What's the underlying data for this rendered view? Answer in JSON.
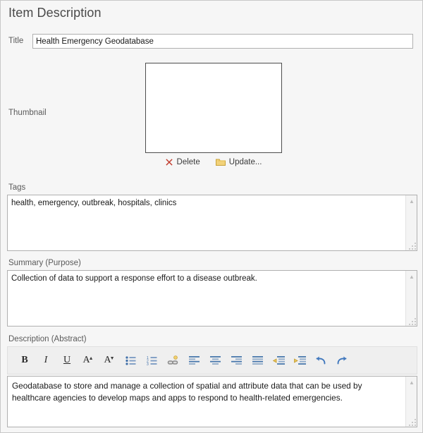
{
  "header": {
    "title": "Item Description"
  },
  "title_field": {
    "label": "Title",
    "value": "Health Emergency Geodatabase",
    "placeholder": ""
  },
  "thumbnail": {
    "label": "Thumbnail",
    "image": "",
    "delete_label": "Delete",
    "delete_icon": "close-x-icon",
    "update_label": "Update...",
    "update_icon": "folder-icon",
    "delete_icon_color": "#c0392b",
    "folder_icon_color": "#e8c35a"
  },
  "tags": {
    "label": "Tags",
    "value": "health, emergency, outbreak, hospitals, clinics",
    "placeholder": ""
  },
  "summary": {
    "label": "Summary (Purpose)",
    "value": "Collection of data to support a response effort to a disease outbreak.",
    "placeholder": ""
  },
  "description": {
    "label": "Description (Abstract)",
    "value": "Geodatabase to store and manage a collection of spatial and attribute data that can be used by healthcare agencies to develop maps and apps to respond to health-related emergencies.",
    "placeholder": "",
    "toolbar": [
      {
        "name": "bold-icon",
        "label": "B",
        "tip": "Bold"
      },
      {
        "name": "italic-icon",
        "label": "I",
        "tip": "Italic"
      },
      {
        "name": "underline-icon",
        "label": "U",
        "tip": "Underline"
      },
      {
        "name": "increase-font-size-icon",
        "label": "A",
        "tip": "Increase Font Size"
      },
      {
        "name": "decrease-font-size-icon",
        "label": "A",
        "tip": "Decrease Font Size"
      },
      {
        "name": "bulleted-list-icon",
        "label": "",
        "tip": "Bulleted List"
      },
      {
        "name": "numbered-list-icon",
        "label": "",
        "tip": "Numbered List"
      },
      {
        "name": "hyperlink-icon",
        "label": "",
        "tip": "Hyperlink"
      },
      {
        "name": "align-left-icon",
        "label": "",
        "tip": "Align Left"
      },
      {
        "name": "align-center-icon",
        "label": "",
        "tip": "Align Center"
      },
      {
        "name": "align-right-icon",
        "label": "",
        "tip": "Align Right"
      },
      {
        "name": "justify-icon",
        "label": "",
        "tip": "Justify"
      },
      {
        "name": "decrease-indent-icon",
        "label": "",
        "tip": "Decrease Indent"
      },
      {
        "name": "increase-indent-icon",
        "label": "",
        "tip": "Increase Indent"
      },
      {
        "name": "undo-icon",
        "label": "",
        "tip": "Undo"
      },
      {
        "name": "redo-icon",
        "label": "",
        "tip": "Redo"
      }
    ]
  },
  "colors": {
    "page_background": "#f6f6f6",
    "field_border": "#b0b0b0",
    "toolbar_background": "#efefef",
    "title_text": "#4a4a4a",
    "label_text": "#5a5a5a",
    "icon_blue": "#3f6fa8",
    "icon_gold": "#e0b040"
  }
}
